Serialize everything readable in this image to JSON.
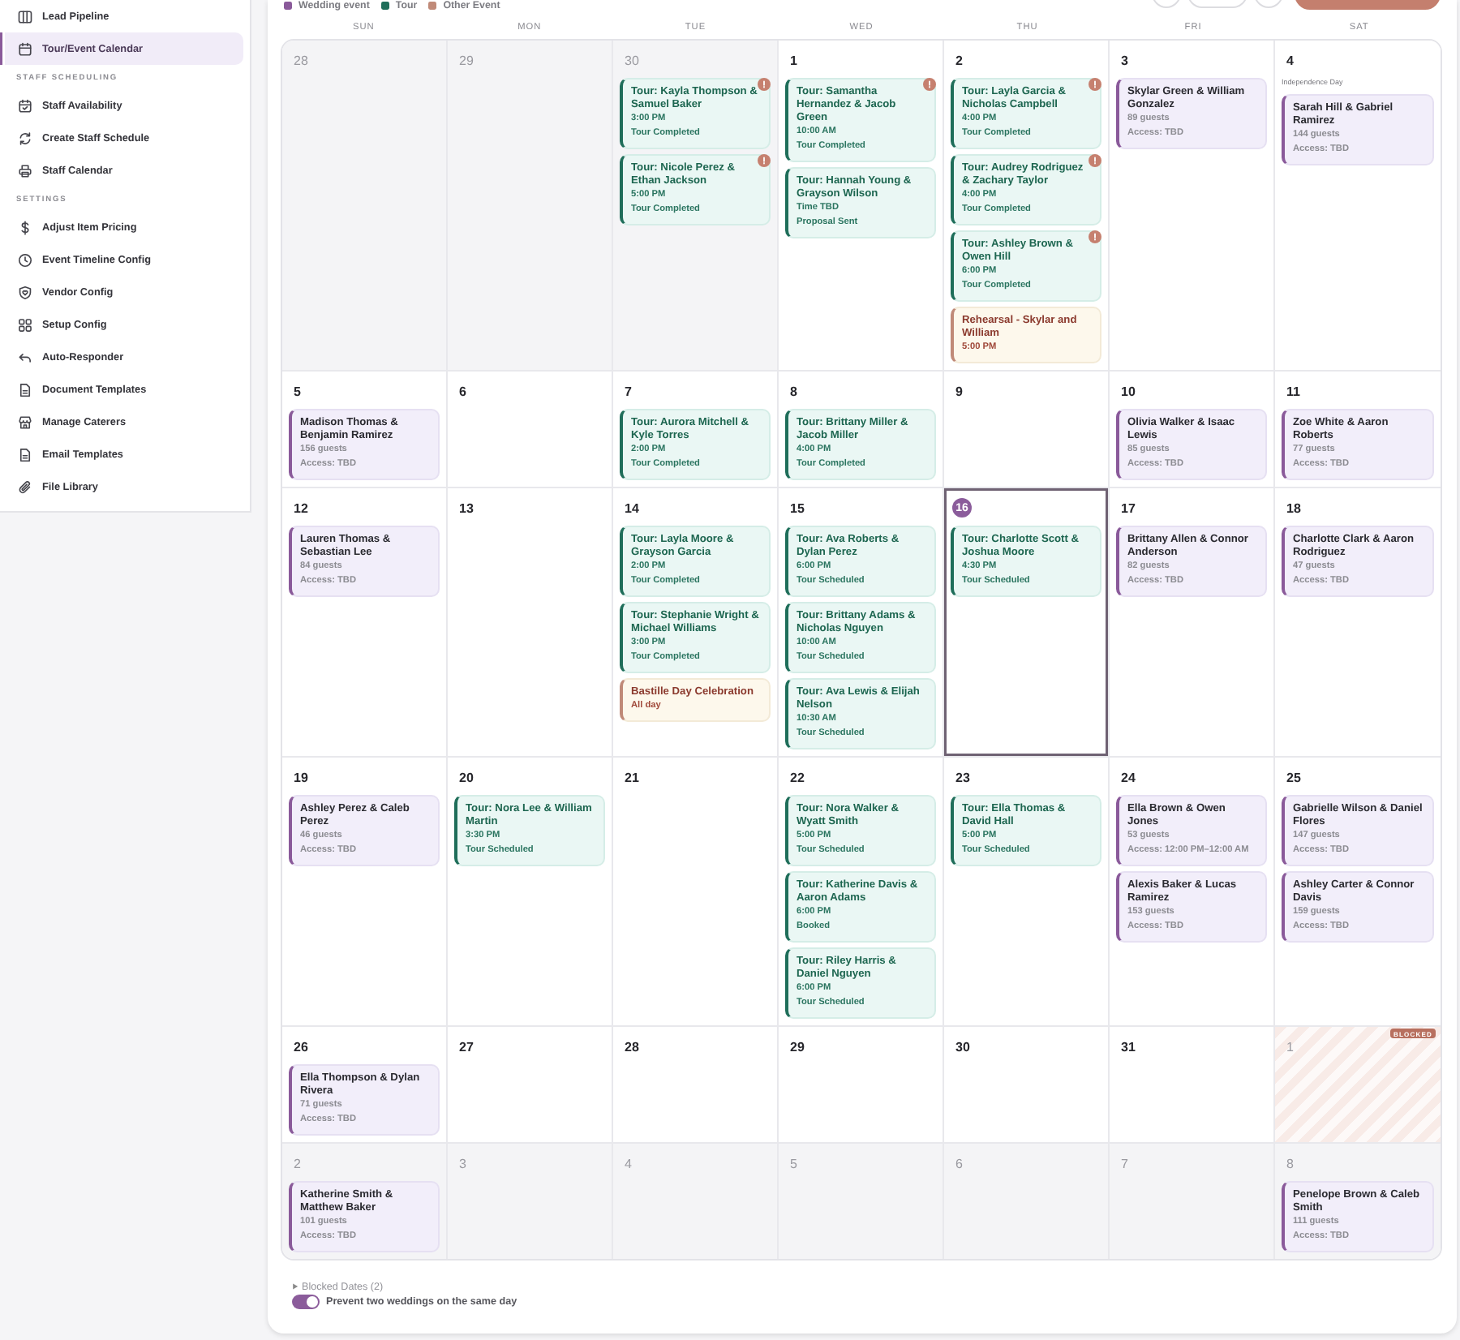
{
  "sidebar": {
    "sections": [
      {
        "items": [
          {
            "label": "Lead Pipeline",
            "selected": false
          },
          {
            "label": "Tour/Event Calendar",
            "selected": true
          }
        ]
      },
      {
        "heading": "STAFF SCHEDULING",
        "items": [
          {
            "label": "Staff Availability",
            "selected": false
          },
          {
            "label": "Create Staff Schedule",
            "selected": false
          },
          {
            "label": "Staff Calendar",
            "selected": false
          }
        ]
      },
      {
        "heading": "SETTINGS",
        "items": [
          {
            "label": "Adjust Item Pricing",
            "selected": false
          },
          {
            "label": "Event Timeline Config",
            "selected": false
          },
          {
            "label": "Vendor Config",
            "selected": false
          },
          {
            "label": "Setup Config",
            "selected": false
          },
          {
            "label": "Auto-Responder",
            "selected": false
          },
          {
            "label": "Document Templates",
            "selected": false
          },
          {
            "label": "Manage Caterers",
            "selected": false
          },
          {
            "label": "Email Templates",
            "selected": false
          },
          {
            "label": "File Library",
            "selected": false
          }
        ]
      }
    ]
  },
  "calendar": {
    "legend": [
      {
        "label": "Wedding event",
        "color": "#8a5a9a"
      },
      {
        "label": "Tour",
        "color": "#1f6e5a"
      },
      {
        "label": "Other Event",
        "color": "#c08a78"
      }
    ],
    "weekdays": [
      "SUN",
      "MON",
      "TUE",
      "WED",
      "THU",
      "FRI",
      "SAT"
    ],
    "weeks": [
      [
        {
          "date": "28",
          "outside": true,
          "today": false,
          "blocked": false
        },
        {
          "date": "29",
          "outside": true,
          "today": false,
          "blocked": false
        },
        {
          "date": "30",
          "outside": true,
          "today": false,
          "blocked": false,
          "events": [
            {
              "kind": "tour",
              "title": "Tour: Kayla Thompson & Samuel Baker",
              "time": "3:00 PM",
              "status": "Tour Completed",
              "flagged": true
            },
            {
              "kind": "tour",
              "title": "Tour: Nicole Perez & Ethan Jackson",
              "time": "5:00 PM",
              "status": "Tour Completed",
              "flagged": true
            }
          ]
        },
        {
          "date": "1",
          "outside": false,
          "today": false,
          "blocked": false,
          "events": [
            {
              "kind": "tour",
              "title": "Tour: Samantha Hernandez & Jacob Green",
              "time": "10:00 AM",
              "status": "Tour Completed",
              "flagged": true
            },
            {
              "kind": "tour",
              "title": "Tour: Hannah Young & Grayson Wilson",
              "time": "Time TBD",
              "status": "Proposal Sent",
              "flagged": false
            }
          ]
        },
        {
          "date": "2",
          "outside": false,
          "today": false,
          "blocked": false,
          "events": [
            {
              "kind": "tour",
              "title": "Tour: Layla Garcia & Nicholas Campbell",
              "time": "4:00 PM",
              "status": "Tour Completed",
              "flagged": true
            },
            {
              "kind": "tour",
              "title": "Tour: Audrey Rodriguez & Zachary Taylor",
              "time": "4:00 PM",
              "status": "Tour Completed",
              "flagged": true
            },
            {
              "kind": "tour",
              "title": "Tour: Ashley Brown & Owen Hill",
              "time": "6:00 PM",
              "status": "Tour Completed",
              "flagged": true
            },
            {
              "kind": "other",
              "title": "Rehearsal - Skylar and William",
              "time": "5:00 PM",
              "flagged": false
            }
          ]
        },
        {
          "date": "3",
          "outside": false,
          "today": false,
          "blocked": false,
          "events": [
            {
              "kind": "wedding",
              "title": "Skylar Green & William Gonzalez",
              "guests": "89 guests",
              "access": "Access: TBD",
              "flagged": false
            }
          ]
        },
        {
          "date": "4",
          "outside": false,
          "today": false,
          "blocked": false,
          "holiday": "Independence Day",
          "events": [
            {
              "kind": "wedding",
              "title": "Sarah Hill & Gabriel Ramirez",
              "guests": "144 guests",
              "access": "Access: TBD",
              "flagged": false
            }
          ]
        }
      ],
      [
        {
          "date": "5",
          "outside": false,
          "today": false,
          "blocked": false,
          "events": [
            {
              "kind": "wedding",
              "title": "Madison Thomas & Benjamin Ramirez",
              "guests": "156 guests",
              "access": "Access: TBD",
              "flagged": false
            }
          ]
        },
        {
          "date": "6",
          "outside": false,
          "today": false,
          "blocked": false
        },
        {
          "date": "7",
          "outside": false,
          "today": false,
          "blocked": false,
          "events": [
            {
              "kind": "tour",
              "title": "Tour: Aurora Mitchell & Kyle Torres",
              "time": "2:00 PM",
              "status": "Tour Completed",
              "flagged": false
            }
          ]
        },
        {
          "date": "8",
          "outside": false,
          "today": false,
          "blocked": false,
          "events": [
            {
              "kind": "tour",
              "title": "Tour: Brittany Miller & Jacob Miller",
              "time": "4:00 PM",
              "status": "Tour Completed",
              "flagged": false
            }
          ]
        },
        {
          "date": "9",
          "outside": false,
          "today": false,
          "blocked": false
        },
        {
          "date": "10",
          "outside": false,
          "today": false,
          "blocked": false,
          "events": [
            {
              "kind": "wedding",
              "title": "Olivia Walker & Isaac Lewis",
              "guests": "85 guests",
              "access": "Access: TBD",
              "flagged": false
            }
          ]
        },
        {
          "date": "11",
          "outside": false,
          "today": false,
          "blocked": false,
          "events": [
            {
              "kind": "wedding",
              "title": "Zoe White & Aaron Roberts",
              "guests": "77 guests",
              "access": "Access: TBD",
              "flagged": false
            }
          ]
        }
      ],
      [
        {
          "date": "12",
          "outside": false,
          "today": false,
          "blocked": false,
          "events": [
            {
              "kind": "wedding",
              "title": "Lauren Thomas & Sebastian Lee",
              "guests": "84 guests",
              "access": "Access: TBD",
              "flagged": false
            }
          ]
        },
        {
          "date": "13",
          "outside": false,
          "today": false,
          "blocked": false
        },
        {
          "date": "14",
          "outside": false,
          "today": false,
          "blocked": false,
          "events": [
            {
              "kind": "tour",
              "title": "Tour: Layla Moore & Grayson Garcia",
              "time": "2:00 PM",
              "status": "Tour Completed",
              "flagged": false
            },
            {
              "kind": "tour",
              "title": "Tour: Stephanie Wright & Michael Williams",
              "time": "3:00 PM",
              "status": "Tour Completed",
              "flagged": false
            },
            {
              "kind": "other",
              "title": "Bastille Day Celebration",
              "time": "All day",
              "flagged": false
            }
          ]
        },
        {
          "date": "15",
          "outside": false,
          "today": false,
          "blocked": false,
          "events": [
            {
              "kind": "tour",
              "title": "Tour: Ava Roberts & Dylan Perez",
              "time": "6:00 PM",
              "status": "Tour Scheduled",
              "flagged": false
            },
            {
              "kind": "tour",
              "title": "Tour: Brittany Adams & Nicholas Nguyen",
              "time": "10:00 AM",
              "status": "Tour Scheduled",
              "flagged": false
            },
            {
              "kind": "tour",
              "title": "Tour: Ava Lewis & Elijah Nelson",
              "time": "10:30 AM",
              "status": "Tour Scheduled",
              "flagged": false
            }
          ]
        },
        {
          "date": "16",
          "outside": false,
          "today": true,
          "blocked": false,
          "events": [
            {
              "kind": "tour",
              "title": "Tour: Charlotte Scott & Joshua Moore",
              "time": "4:30 PM",
              "status": "Tour Scheduled",
              "flagged": false
            }
          ]
        },
        {
          "date": "17",
          "outside": false,
          "today": false,
          "blocked": false,
          "events": [
            {
              "kind": "wedding",
              "title": "Brittany Allen & Connor Anderson",
              "guests": "82 guests",
              "access": "Access: TBD",
              "flagged": false
            }
          ]
        },
        {
          "date": "18",
          "outside": false,
          "today": false,
          "blocked": false,
          "events": [
            {
              "kind": "wedding",
              "title": "Charlotte Clark & Aaron Rodriguez",
              "guests": "47 guests",
              "access": "Access: TBD",
              "flagged": false
            }
          ]
        }
      ],
      [
        {
          "date": "19",
          "outside": false,
          "today": false,
          "blocked": false,
          "events": [
            {
              "kind": "wedding",
              "title": "Ashley Perez & Caleb Perez",
              "guests": "46 guests",
              "access": "Access: TBD",
              "flagged": false
            }
          ]
        },
        {
          "date": "20",
          "outside": false,
          "today": false,
          "blocked": false,
          "events": [
            {
              "kind": "tour",
              "title": "Tour: Nora Lee & William Martin",
              "time": "3:30 PM",
              "status": "Tour Scheduled",
              "flagged": false
            }
          ]
        },
        {
          "date": "21",
          "outside": false,
          "today": false,
          "blocked": false
        },
        {
          "date": "22",
          "outside": false,
          "today": false,
          "blocked": false,
          "events": [
            {
              "kind": "tour",
              "title": "Tour: Nora Walker & Wyatt Smith",
              "time": "5:00 PM",
              "status": "Tour Scheduled",
              "flagged": false
            },
            {
              "kind": "tour",
              "title": "Tour: Katherine Davis & Aaron Adams",
              "time": "6:00 PM",
              "status": "Booked",
              "flagged": false
            },
            {
              "kind": "tour",
              "title": "Tour: Riley Harris & Daniel Nguyen",
              "time": "6:00 PM",
              "status": "Tour Scheduled",
              "flagged": false
            }
          ]
        },
        {
          "date": "23",
          "outside": false,
          "today": false,
          "blocked": false,
          "events": [
            {
              "kind": "tour",
              "title": "Tour: Ella Thomas & David Hall",
              "time": "5:00 PM",
              "status": "Tour Scheduled",
              "flagged": false
            }
          ]
        },
        {
          "date": "24",
          "outside": false,
          "today": false,
          "blocked": false,
          "events": [
            {
              "kind": "wedding",
              "title": "Ella Brown & Owen Jones",
              "guests": "53 guests",
              "access": "Access: 12:00 PM–12:00 AM",
              "flagged": false
            },
            {
              "kind": "wedding",
              "title": "Alexis Baker & Lucas Ramirez",
              "guests": "153 guests",
              "access": "Access: TBD",
              "flagged": false
            }
          ]
        },
        {
          "date": "25",
          "outside": false,
          "today": false,
          "blocked": false,
          "events": [
            {
              "kind": "wedding",
              "title": "Gabrielle Wilson & Daniel Flores",
              "guests": "147 guests",
              "access": "Access: TBD",
              "flagged": false
            },
            {
              "kind": "wedding",
              "title": "Ashley Carter & Connor Davis",
              "guests": "159 guests",
              "access": "Access: TBD",
              "flagged": false
            }
          ]
        }
      ],
      [
        {
          "date": "26",
          "outside": false,
          "today": false,
          "blocked": false,
          "events": [
            {
              "kind": "wedding",
              "title": "Ella Thompson & Dylan Rivera",
              "guests": "71 guests",
              "access": "Access: TBD",
              "flagged": false
            }
          ]
        },
        {
          "date": "27",
          "outside": false,
          "today": false,
          "blocked": false
        },
        {
          "date": "28",
          "outside": false,
          "today": false,
          "blocked": false
        },
        {
          "date": "29",
          "outside": false,
          "today": false,
          "blocked": false
        },
        {
          "date": "30",
          "outside": false,
          "today": false,
          "blocked": false
        },
        {
          "date": "31",
          "outside": false,
          "today": false,
          "blocked": false
        },
        {
          "date": "1",
          "outside": true,
          "today": false,
          "blocked": true,
          "tag": "BLOCKED"
        }
      ],
      [
        {
          "date": "2",
          "outside": true,
          "today": false,
          "blocked": false,
          "events": [
            {
              "kind": "wedding",
              "title": "Katherine Smith & Matthew Baker",
              "guests": "101 guests",
              "access": "Access: TBD",
              "flagged": false
            }
          ]
        },
        {
          "date": "3",
          "outside": true,
          "today": false,
          "blocked": false
        },
        {
          "date": "4",
          "outside": true,
          "today": false,
          "blocked": false
        },
        {
          "date": "5",
          "outside": true,
          "today": false,
          "blocked": false
        },
        {
          "date": "6",
          "outside": true,
          "today": false,
          "blocked": false
        },
        {
          "date": "7",
          "outside": true,
          "today": false,
          "blocked": false
        },
        {
          "date": "8",
          "outside": true,
          "today": false,
          "blocked": false,
          "events": [
            {
              "kind": "wedding",
              "title": "Penelope Brown & Caleb Smith",
              "guests": "111 guests",
              "access": "Access: TBD",
              "flagged": false
            }
          ]
        }
      ]
    ]
  },
  "footer": {
    "blocked_dates": {
      "label": "Blocked Dates (2)",
      "expanded": false
    },
    "prevent_double": {
      "label": "Prevent two weddings on the same day",
      "on": true
    }
  }
}
